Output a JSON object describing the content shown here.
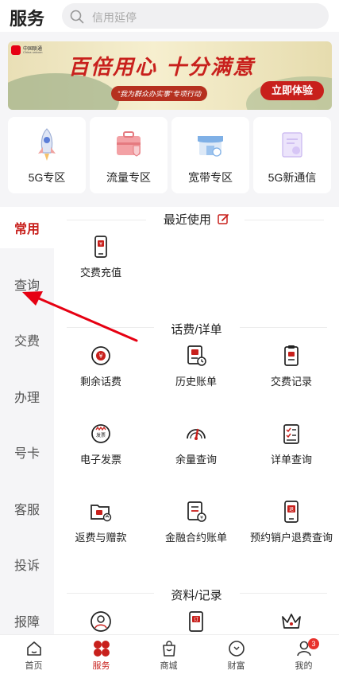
{
  "header": {
    "title": "服务",
    "search_placeholder": "信用延停"
  },
  "banner": {
    "brand_cn": "中国联通",
    "brand_en": "China unicom",
    "slogan": "百倍用心 十分满意",
    "subtitle": "“我为群众办实事”专项行动",
    "cta": "立即体验"
  },
  "quick_entries": [
    {
      "label": "5G专区",
      "icon": "rocket-icon"
    },
    {
      "label": "流量专区",
      "icon": "suitcase-icon"
    },
    {
      "label": "宽带专区",
      "icon": "store-icon"
    },
    {
      "label": "5G新通信",
      "icon": "certificate-icon"
    }
  ],
  "sidebar": {
    "items": [
      "常用",
      "查询",
      "交费",
      "办理",
      "号卡",
      "客服",
      "投诉",
      "报障"
    ],
    "active": "常用"
  },
  "content": {
    "recent": {
      "title": "最近使用",
      "items": [
        {
          "label": "交费充值",
          "icon": "phone-pay-icon"
        }
      ]
    },
    "billing": {
      "title": "话费/详单",
      "items": [
        {
          "label": "剩余话费",
          "icon": "yuan-circle-icon"
        },
        {
          "label": "历史账单",
          "icon": "history-bill-icon"
        },
        {
          "label": "交费记录",
          "icon": "clipboard-icon"
        },
        {
          "label": "电子发票",
          "icon": "invoice-icon"
        },
        {
          "label": "余量查询",
          "icon": "gauge-icon"
        },
        {
          "label": "详单查询",
          "icon": "checklist-icon"
        },
        {
          "label": "返费与赠款",
          "icon": "folder-refund-icon"
        },
        {
          "label": "金融合约账单",
          "icon": "finance-bill-icon"
        },
        {
          "label": "预约销户退费查询",
          "icon": "phone-refund-icon"
        }
      ]
    },
    "records": {
      "title": "资料/记录",
      "items": [
        {
          "icon": "user-profile-icon"
        },
        {
          "icon": "order-icon"
        },
        {
          "icon": "crown-icon"
        }
      ]
    }
  },
  "bottom_nav": {
    "tabs": [
      "首页",
      "服务",
      "商城",
      "财富",
      "我的"
    ],
    "active": "服务",
    "badge": "3"
  },
  "colors": {
    "accent": "#c8201c",
    "badge": "#e8322c",
    "annotation_arrow": "#e60012"
  }
}
